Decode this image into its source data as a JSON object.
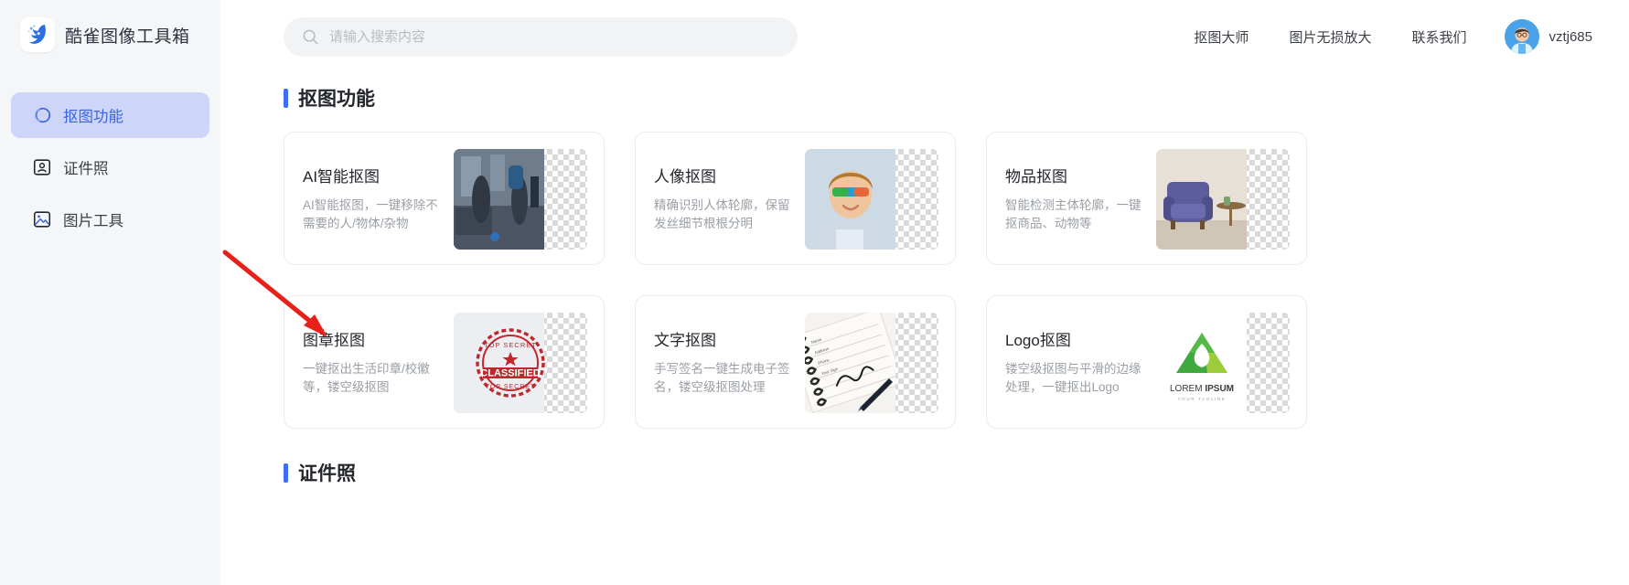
{
  "brand": {
    "title": "酷雀图像工具箱",
    "logo_icon": "bird-logo-icon"
  },
  "sidebar": {
    "items": [
      {
        "label": "抠图功能",
        "icon": "cutout-circle-icon",
        "active": true
      },
      {
        "label": "证件照",
        "icon": "id-photo-icon",
        "active": false
      },
      {
        "label": "图片工具",
        "icon": "image-tools-icon",
        "active": false
      }
    ]
  },
  "search": {
    "placeholder": "请输入搜索内容",
    "value": "",
    "icon": "search-icon"
  },
  "topnav": {
    "links": [
      "抠图大师",
      "图片无损放大",
      "联系我们"
    ],
    "username": "vztj685"
  },
  "sections": [
    {
      "title": "抠图功能",
      "cards": [
        {
          "title": "AI智能抠图",
          "desc": "AI智能抠图，一键移除不需要的人/物体/杂物",
          "thumb": "boxing-gym-photo"
        },
        {
          "title": "人像抠图",
          "desc": "精确识别人体轮廓，保留发丝细节根根分明",
          "thumb": "boy-sunglasses-photo"
        },
        {
          "title": "物品抠图",
          "desc": "智能检测主体轮廓，一键抠商品、动物等",
          "thumb": "armchair-photo"
        },
        {
          "title": "图章抠图",
          "desc": "一键抠出生活印章/校徽等，镂空级抠图",
          "thumb": "classified-stamp-photo"
        },
        {
          "title": "文字抠图",
          "desc": "手写签名一键生成电子签名，镂空级抠图处理",
          "thumb": "notebook-signature-photo"
        },
        {
          "title": "Logo抠图",
          "desc": "镂空级抠图与平滑的边缘处理，一键抠出Logo",
          "thumb": "lorem-ipsum-logo-photo"
        }
      ]
    },
    {
      "title": "证件照",
      "cards": []
    }
  ],
  "annotation": {
    "type": "red-arrow",
    "points_to": "图章抠图"
  },
  "colors": {
    "accent": "#3b6ef0",
    "sidebar_bg": "#f5f6f8",
    "active_bg": "#cdd6f8",
    "active_text": "#3b63e0",
    "annotation_red": "#e8201a",
    "muted_text": "#9a9ea6"
  }
}
